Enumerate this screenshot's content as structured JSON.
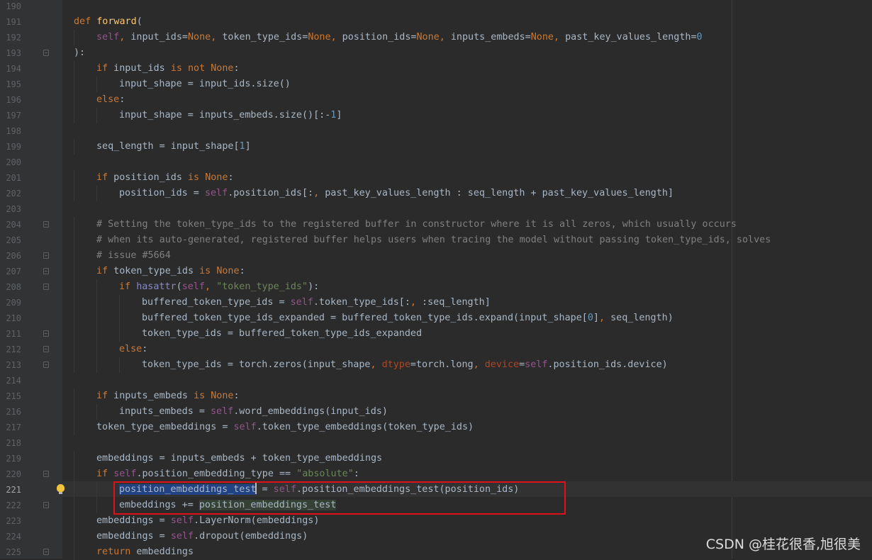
{
  "editor": {
    "current_line": "221",
    "lines": [
      {
        "n": "190"
      },
      {
        "n": "191",
        "t": "def forward("
      },
      {
        "n": "192",
        "t": "self, input_ids=None, token_type_ids=None, position_ids=None, inputs_embeds=None, past_key_values_length=0"
      },
      {
        "n": "193",
        "t": "):"
      },
      {
        "n": "194",
        "t": "if input_ids is not None:"
      },
      {
        "n": "195",
        "t": "input_shape = input_ids.size()"
      },
      {
        "n": "196",
        "t": "else:"
      },
      {
        "n": "197",
        "t": "input_shape = inputs_embeds.size()[:-1]"
      },
      {
        "n": "198"
      },
      {
        "n": "199",
        "t": "seq_length = input_shape[1]"
      },
      {
        "n": "200"
      },
      {
        "n": "201",
        "t": "if position_ids is None:"
      },
      {
        "n": "202",
        "t": "position_ids = self.position_ids[:, past_key_values_length : seq_length + past_key_values_length]"
      },
      {
        "n": "203"
      },
      {
        "n": "204",
        "t": "# Setting the token_type_ids to the registered buffer in constructor where it is all zeros, which usually occurs"
      },
      {
        "n": "205",
        "t": "# when its auto-generated, registered buffer helps users when tracing the model without passing token_type_ids, solves"
      },
      {
        "n": "206",
        "t": "# issue #5664"
      },
      {
        "n": "207",
        "t": "if token_type_ids is None:"
      },
      {
        "n": "208",
        "t": "if hasattr(self, \"token_type_ids\"):"
      },
      {
        "n": "209",
        "t": "buffered_token_type_ids = self.token_type_ids[:, :seq_length]"
      },
      {
        "n": "210",
        "t": "buffered_token_type_ids_expanded = buffered_token_type_ids.expand(input_shape[0], seq_length)"
      },
      {
        "n": "211",
        "t": "token_type_ids = buffered_token_type_ids_expanded"
      },
      {
        "n": "212",
        "t": "else:"
      },
      {
        "n": "213",
        "t": "token_type_ids = torch.zeros(input_shape, dtype=torch.long, device=self.position_ids.device)"
      },
      {
        "n": "214"
      },
      {
        "n": "215",
        "t": "if inputs_embeds is None:"
      },
      {
        "n": "216",
        "t": "inputs_embeds = self.word_embeddings(input_ids)"
      },
      {
        "n": "217",
        "t": "token_type_embeddings = self.token_type_embeddings(token_type_ids)"
      },
      {
        "n": "218"
      },
      {
        "n": "219",
        "t": "embeddings = inputs_embeds + token_type_embeddings"
      },
      {
        "n": "220",
        "t": "if self.position_embedding_type == \"absolute\":"
      },
      {
        "n": "221",
        "t": "position_embeddings_test = self.position_embeddings_test(position_ids)"
      },
      {
        "n": "222",
        "t": "embeddings += position_embeddings_test"
      },
      {
        "n": "223",
        "t": "embeddings = self.LayerNorm(embeddings)"
      },
      {
        "n": "224",
        "t": "embeddings = self.dropout(embeddings)"
      },
      {
        "n": "225",
        "t": "return embeddings"
      }
    ]
  },
  "watermark": "CSDN @桂花很香,旭很美"
}
